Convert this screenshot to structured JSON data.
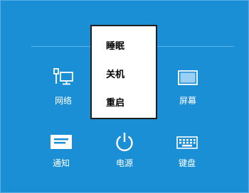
{
  "settings_panel": {
    "tiles": {
      "network": {
        "label": "网络",
        "icon": "network-icon"
      },
      "screen": {
        "label": "屏幕",
        "icon": "screen-icon"
      },
      "notifications": {
        "label": "通知",
        "icon": "notifications-icon"
      },
      "power": {
        "label": "电源",
        "icon": "power-icon"
      },
      "keyboard": {
        "label": "键盘",
        "icon": "keyboard-icon"
      }
    }
  },
  "power_menu": {
    "items": [
      "睡眠",
      "关机",
      "重启"
    ]
  },
  "colors": {
    "panel_background": "#1a8fd6",
    "menu_background": "#ffffff",
    "menu_border": "#1e1e1e",
    "icon_foreground": "#ffffff"
  }
}
